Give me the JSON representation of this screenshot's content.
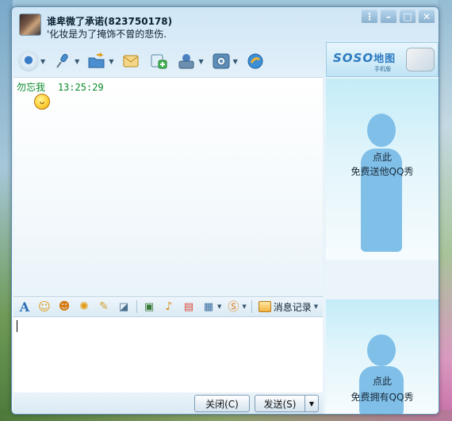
{
  "window": {
    "contact_name": "谁卑微了承诺(823750178)",
    "signature": "'化妆是为了掩饰不曾的悲伤."
  },
  "toolbar": {
    "items": [
      {
        "name": "video-call",
        "icon": "webcam-icon",
        "has_dropdown": true
      },
      {
        "name": "voice-call",
        "icon": "microphone-icon",
        "has_dropdown": true
      },
      {
        "name": "send-file",
        "icon": "folder-send-icon",
        "has_dropdown": true
      },
      {
        "name": "send-message",
        "icon": "envelope-icon",
        "has_dropdown": false
      },
      {
        "name": "create-group",
        "icon": "add-group-icon",
        "has_dropdown": false
      },
      {
        "name": "more-apps",
        "icon": "app-kit-icon",
        "has_dropdown": true
      },
      {
        "name": "settings",
        "icon": "gear-icon",
        "has_dropdown": true
      },
      {
        "name": "remote",
        "icon": "share-icon",
        "has_dropdown": false
      }
    ]
  },
  "messages": [
    {
      "sender": "勿忘我",
      "time": "13:25:29",
      "content_icon": "grin-emoji-icon"
    }
  ],
  "format_bar": {
    "history_label": "消息记录"
  },
  "buttons": {
    "close_label": "关闭(C)",
    "send_label": "发送(S)"
  },
  "right_panel": {
    "banner_logo": "SOSO",
    "banner_logo_suffix": "地图",
    "banner_sub": "手机版",
    "show_top": {
      "line1": "点此",
      "line2": "免费送他QQ秀"
    },
    "show_bottom": {
      "line1": "点此",
      "line2": "免费拥有QQ秀"
    }
  },
  "colors": {
    "sender_green": "#0a8a2a",
    "accent_blue": "#2d7bc0",
    "silhouette": "#7fbfe8"
  }
}
